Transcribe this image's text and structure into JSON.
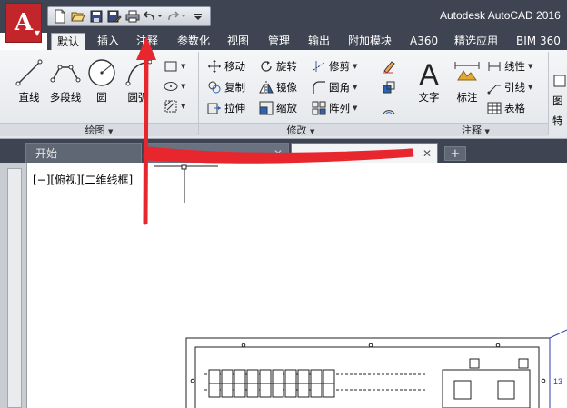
{
  "app": {
    "title": "Autodesk AutoCAD 2016",
    "logo_letter": "A"
  },
  "quick_access": {
    "icons": [
      "new-icon",
      "open-icon",
      "save-icon",
      "save-as-icon",
      "print-icon",
      "undo-icon",
      "redo-icon",
      "customize-icon"
    ]
  },
  "ribbon_tabs": [
    "默认",
    "插入",
    "注释",
    "参数化",
    "视图",
    "管理",
    "输出",
    "附加模块",
    "A360",
    "精选应用",
    "BIM 360"
  ],
  "panels": {
    "draw": {
      "title": "绘图",
      "big_buttons": [
        "直线",
        "多段线",
        "圆",
        "圆弧"
      ]
    },
    "modify": {
      "title": "修改",
      "buttons": [
        "移动",
        "旋转",
        "修剪",
        "复制",
        "镜像",
        "圆角",
        "拉伸",
        "缩放",
        "阵列"
      ]
    },
    "annotation": {
      "title": "注释",
      "big_buttons": [
        "文字",
        "标注"
      ],
      "small_buttons": [
        "线性",
        "引线",
        "表格"
      ]
    },
    "layers": {
      "partial_label_1": "图",
      "partial_label_2": "特"
    }
  },
  "doc_tabs": {
    "start": "开始",
    "add": "+"
  },
  "viewport": {
    "label": "[−][俯视][二维线框]"
  },
  "annotations": {
    "arrow_color": "#e8262d",
    "redaction_color": "#e8262d"
  }
}
